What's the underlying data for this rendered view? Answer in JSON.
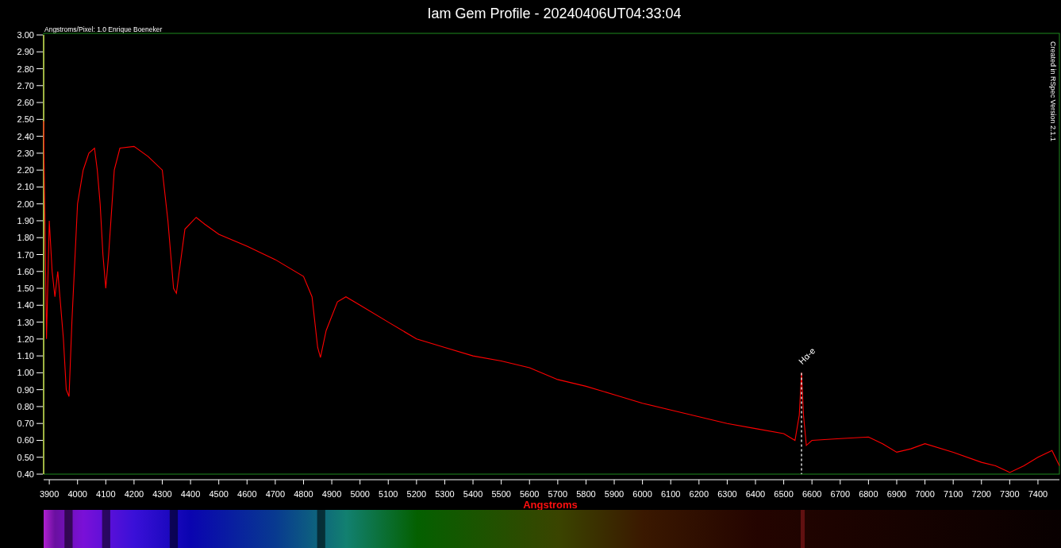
{
  "title": "Iam Gem Profile - 20240406UT04:33:04",
  "caption": "Angstroms/Pixel: 1.0 Enrique Boeneker",
  "credit": "Created in RSpec Version 2.1.1",
  "chart_data": {
    "type": "line",
    "xlabel": "Angstroms",
    "x": [
      3880,
      3890,
      3900,
      3910,
      3920,
      3930,
      3940,
      3950,
      3960,
      3970,
      3980,
      4000,
      4020,
      4040,
      4060,
      4070,
      4080,
      4090,
      4100,
      4110,
      4130,
      4150,
      4200,
      4250,
      4300,
      4320,
      4340,
      4350,
      4360,
      4380,
      4420,
      4450,
      4500,
      4600,
      4700,
      4800,
      4830,
      4850,
      4860,
      4880,
      4920,
      4950,
      5000,
      5100,
      5200,
      5300,
      5400,
      5500,
      5600,
      5700,
      5800,
      5900,
      6000,
      6100,
      6200,
      6300,
      6400,
      6500,
      6540,
      6555,
      6563,
      6570,
      6580,
      6600,
      6700,
      6800,
      6850,
      6900,
      6950,
      7000,
      7100,
      7200,
      7250,
      7300,
      7350,
      7400,
      7450,
      7476
    ],
    "series": [
      {
        "color": "#ff0000",
        "values": [
          2.49,
          1.2,
          1.9,
          1.6,
          1.45,
          1.6,
          1.4,
          1.2,
          0.9,
          0.86,
          1.3,
          2.0,
          2.2,
          2.3,
          2.33,
          2.2,
          2.0,
          1.7,
          1.5,
          1.7,
          2.2,
          2.33,
          2.34,
          2.28,
          2.2,
          1.9,
          1.5,
          1.47,
          1.6,
          1.85,
          1.92,
          1.88,
          1.82,
          1.75,
          1.67,
          1.57,
          1.45,
          1.15,
          1.09,
          1.25,
          1.42,
          1.45,
          1.4,
          1.3,
          1.2,
          1.15,
          1.1,
          1.07,
          1.03,
          0.96,
          0.92,
          0.87,
          0.82,
          0.78,
          0.74,
          0.7,
          0.67,
          0.64,
          0.6,
          0.75,
          1.0,
          0.75,
          0.57,
          0.6,
          0.61,
          0.62,
          0.58,
          0.53,
          0.55,
          0.58,
          0.53,
          0.47,
          0.45,
          0.41,
          0.45,
          0.5,
          0.54,
          0.45
        ]
      }
    ],
    "xlim": [
      3880,
      7476
    ],
    "ylim": [
      0.4,
      3.0
    ],
    "xticks": [
      3900,
      4000,
      4100,
      4200,
      4300,
      4400,
      4500,
      4600,
      4700,
      4800,
      4900,
      5000,
      5100,
      5200,
      5300,
      5400,
      5500,
      5600,
      5700,
      5800,
      5900,
      6000,
      6100,
      6200,
      6300,
      6400,
      6500,
      6600,
      6700,
      6800,
      6900,
      7000,
      7100,
      7200,
      7300,
      7400
    ],
    "yticks": [
      {
        "value": 0.4,
        "label": "0.40"
      },
      {
        "value": 0.5,
        "label": "0.50"
      },
      {
        "value": 0.6,
        "label": "0.60"
      },
      {
        "value": 0.7,
        "label": "0.70"
      },
      {
        "value": 0.8,
        "label": "0.80"
      },
      {
        "value": 0.9,
        "label": "0.90"
      },
      {
        "value": 1.0,
        "label": "1.00"
      },
      {
        "value": 1.1,
        "label": "1.10"
      },
      {
        "value": 1.2,
        "label": "1.20"
      },
      {
        "value": 1.3,
        "label": "1.30"
      },
      {
        "value": 1.4,
        "label": "1.40"
      },
      {
        "value": 1.5,
        "label": "1.50"
      },
      {
        "value": 1.6,
        "label": "1.60"
      },
      {
        "value": 1.7,
        "label": "1.70"
      },
      {
        "value": 1.8,
        "label": "1.80"
      },
      {
        "value": 1.9,
        "label": "1.90"
      },
      {
        "value": 2.0,
        "label": "2.00"
      },
      {
        "value": 2.1,
        "label": "2.10"
      },
      {
        "value": 2.2,
        "label": "2.20"
      },
      {
        "value": 2.3,
        "label": "2.30"
      },
      {
        "value": 2.4,
        "label": "2.40"
      },
      {
        "value": 2.5,
        "label": "2.50"
      },
      {
        "value": 2.6,
        "label": "2.60"
      },
      {
        "value": 2.7,
        "label": "2.70"
      },
      {
        "value": 2.8,
        "label": "2.80"
      },
      {
        "value": 2.9,
        "label": "2.90"
      },
      {
        "value": 3.0,
        "label": "3.00"
      }
    ],
    "annotations": [
      {
        "x": 6563,
        "y": 1.0,
        "text": "Hα-e"
      }
    ]
  }
}
